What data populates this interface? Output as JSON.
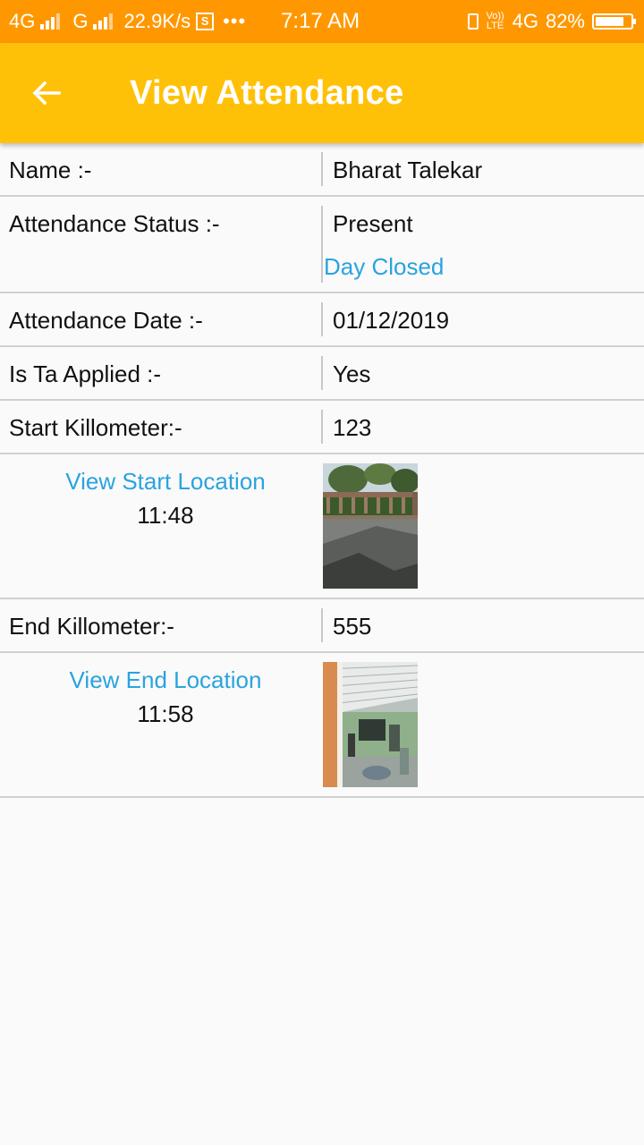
{
  "status_bar": {
    "network1": "4G",
    "network2": "G",
    "speed": "22.9K/s",
    "s_icon": "S",
    "more": "•••",
    "time": "7:17 AM",
    "volte": "Vo)) LTE",
    "network3": "4G",
    "battery": "82%",
    "battery_level": 0.82
  },
  "app_bar": {
    "title": "View Attendance",
    "back_icon": "arrow-left-icon",
    "background": "#ffc107",
    "status_background": "#ff9800"
  },
  "details": {
    "name_label": "Name :-",
    "name_value": "Bharat Talekar",
    "status_label": "Attendance Status :-",
    "status_value": "Present",
    "status_note": "Day Closed",
    "date_label": "Attendance Date :-",
    "date_value": "01/12/2019",
    "ta_label": "Is Ta Applied :-",
    "ta_value": "Yes",
    "start_km_label": "Start Killometer:-",
    "start_km_value": "123",
    "start_location_link": "View Start Location",
    "start_time": "11:48",
    "end_km_label": "End Killometer:-",
    "end_km_value": "555",
    "end_location_link": "View End Location",
    "end_time": "11:58"
  },
  "colors": {
    "link": "#29a3e0",
    "divider": "#d0d0d0"
  }
}
